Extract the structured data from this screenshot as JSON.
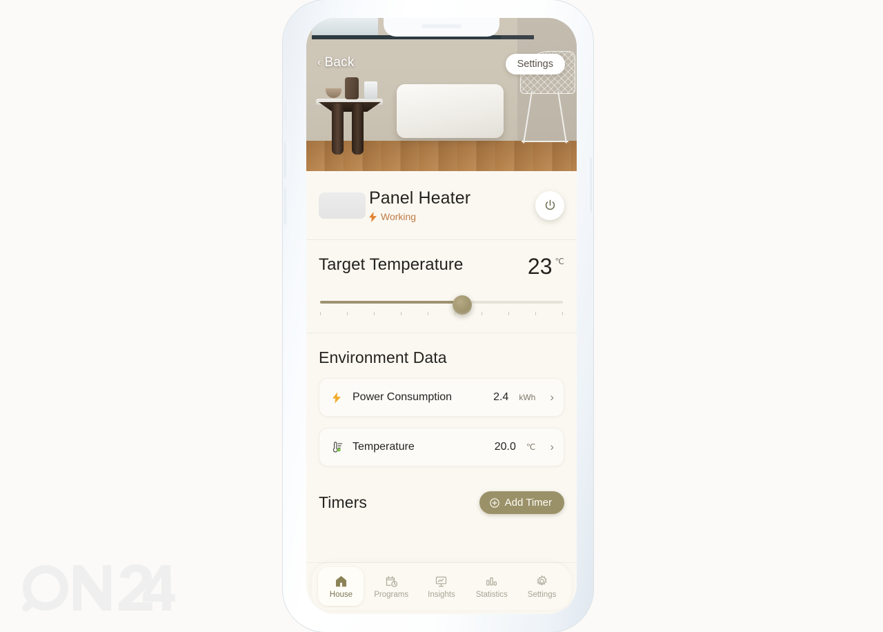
{
  "watermark": {
    "text": "ON24"
  },
  "hero": {
    "back_label": "Back",
    "back_chevron": "chevron-left",
    "settings_label": "Settings"
  },
  "device": {
    "name": "Panel Heater",
    "status": "Working",
    "status_icon": "bolt-icon",
    "power_icon": "power-icon",
    "thumb": "device-thumbnail"
  },
  "target": {
    "label": "Target Temperature",
    "value": "23",
    "unit": "℃",
    "slider_percent": 58.5,
    "tick_count": 10
  },
  "environment": {
    "title": "Environment Data",
    "items": [
      {
        "icon": "bolt-icon",
        "label": "Power Consumption",
        "value": "2.4",
        "unit": "kWh",
        "chevron": "›"
      },
      {
        "icon": "thermometer-icon",
        "label": "Temperature",
        "value": "20.0",
        "unit": "℃",
        "chevron": "›"
      }
    ]
  },
  "timers": {
    "title": "Timers",
    "add_label": "Add Timer",
    "add_icon": "plus-circle-icon"
  },
  "tabs": [
    {
      "label": "House",
      "icon": "home-icon",
      "active": true
    },
    {
      "label": "Programs",
      "icon": "calendar-clock-icon",
      "active": false
    },
    {
      "label": "Insights",
      "icon": "presentation-chart-icon",
      "active": false
    },
    {
      "label": "Statistics",
      "icon": "bar-chart-icon",
      "active": false
    },
    {
      "label": "Settings",
      "icon": "gear-icon",
      "active": false
    }
  ],
  "colors": {
    "accent_olive": "#9b9169",
    "status_orange": "#c07a46",
    "bolt_amber": "#e0822f",
    "sheet_bg": "#faf8f1",
    "temp_green": "#7cc24a"
  }
}
